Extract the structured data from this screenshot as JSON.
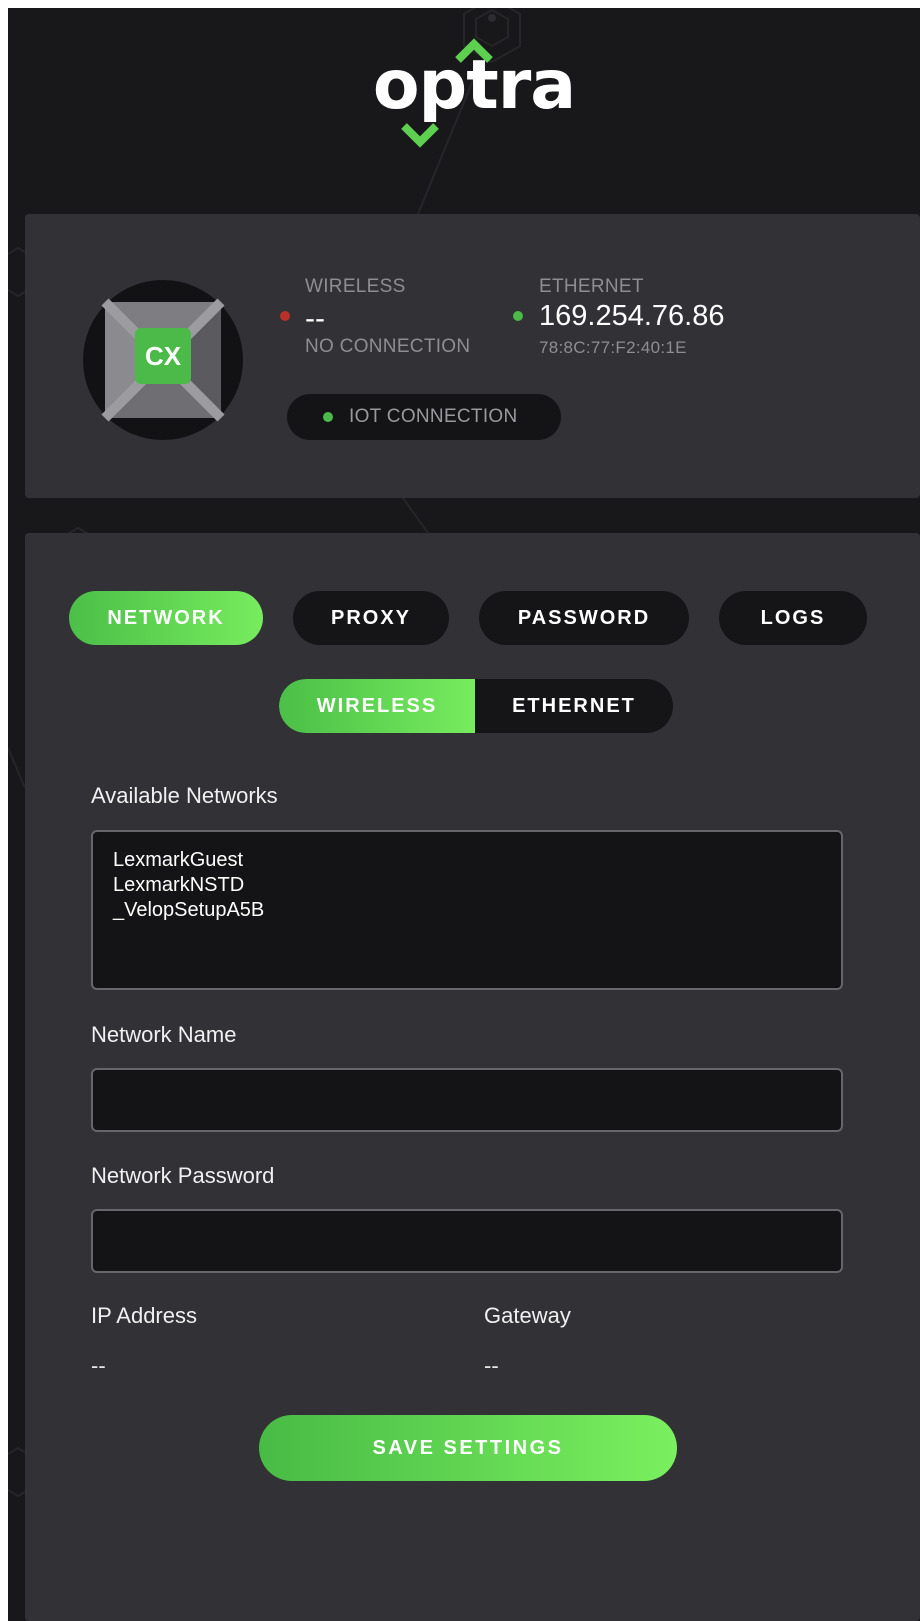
{
  "brand": {
    "logo_text": "optra",
    "accent_color": "#5ed050"
  },
  "status": {
    "device_badge": "CX",
    "wireless": {
      "label": "WIRELESS",
      "value": "--",
      "detail": "NO CONNECTION",
      "indicator_color": "#b8322a"
    },
    "ethernet": {
      "label": "ETHERNET",
      "value": "169.254.76.86",
      "detail": "78:8C:77:F2:40:1E",
      "indicator_color": "#4cba49"
    },
    "iot": {
      "label": "IOT CONNECTION",
      "indicator_color": "#4cba49"
    }
  },
  "tabs": [
    {
      "label": "NETWORK",
      "active": true
    },
    {
      "label": "PROXY",
      "active": false
    },
    {
      "label": "PASSWORD",
      "active": false
    },
    {
      "label": "LOGS",
      "active": false
    }
  ],
  "network_mode": {
    "options": [
      {
        "label": "WIRELESS",
        "active": true
      },
      {
        "label": "ETHERNET",
        "active": false
      }
    ]
  },
  "form": {
    "available_networks_label": "Available Networks",
    "available_networks": [
      "LexmarkGuest",
      "LexmarkNSTD",
      "_VelopSetupA5B"
    ],
    "network_name_label": "Network Name",
    "network_name_value": "",
    "network_password_label": "Network Password",
    "network_password_value": "",
    "ip_address_label": "IP Address",
    "ip_address_value": "--",
    "gateway_label": "Gateway",
    "gateway_value": "--",
    "save_label": "SAVE SETTINGS"
  }
}
